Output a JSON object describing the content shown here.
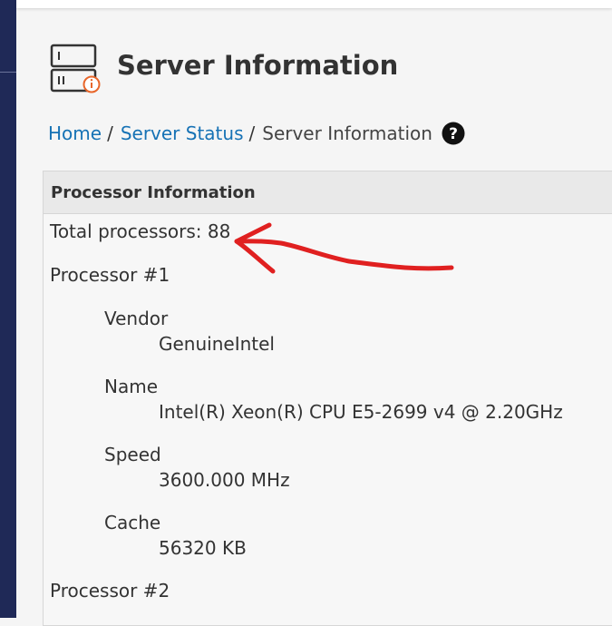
{
  "page": {
    "title": "Server Information"
  },
  "breadcrumb": {
    "items": [
      {
        "label": "Home"
      },
      {
        "label": "Server Status"
      }
    ],
    "separator": "/",
    "current": "Server Information"
  },
  "icons": {
    "page_icon": "server-info-icon",
    "help": "question-circle-icon"
  },
  "processor_info": {
    "header": "Processor Information",
    "total": "Total processors: 88",
    "processors": [
      {
        "title": "Processor #1",
        "fields": [
          {
            "label": "Vendor",
            "value": "GenuineIntel"
          },
          {
            "label": "Name",
            "value": "Intel(R) Xeon(R) CPU E5-2699 v4 @ 2.20GHz"
          },
          {
            "label": "Speed",
            "value": "3600.000 MHz"
          },
          {
            "label": "Cache",
            "value": "56320 KB"
          }
        ]
      },
      {
        "title": "Processor #2"
      }
    ]
  },
  "colors": {
    "sidebar": "#1f2957",
    "link": "#1672b5",
    "annotation": "#e02020",
    "icon_accent": "#e8662a"
  }
}
